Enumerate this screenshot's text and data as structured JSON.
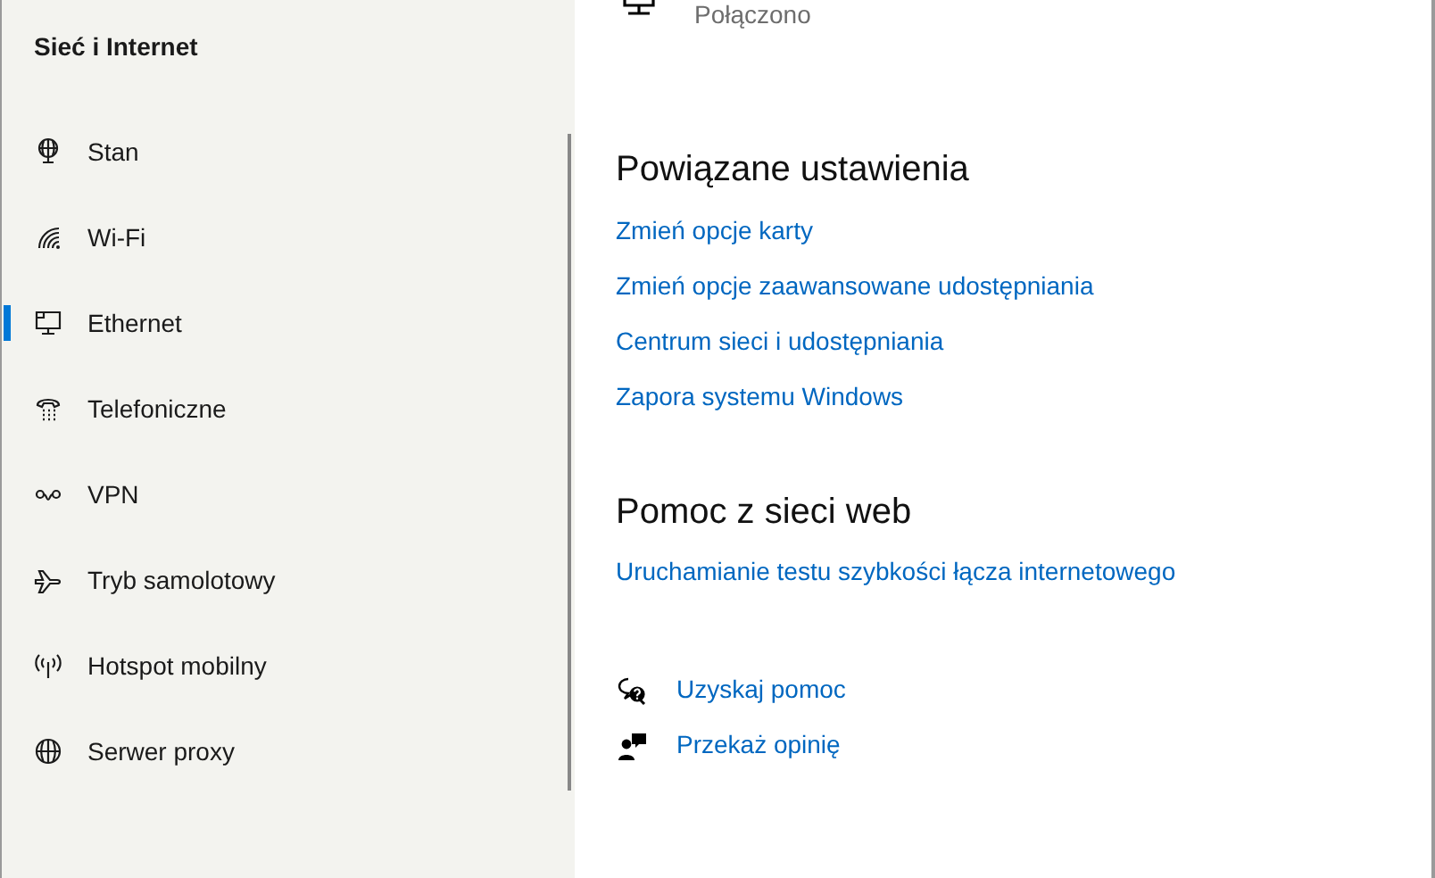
{
  "sidebar": {
    "title": "Sieć i Internet",
    "items": [
      {
        "label": "Stan",
        "kind": "status",
        "selected": false
      },
      {
        "label": "Wi-Fi",
        "kind": "wifi",
        "selected": false
      },
      {
        "label": "Ethernet",
        "kind": "ethernet",
        "selected": true
      },
      {
        "label": "Telefoniczne",
        "kind": "dialup",
        "selected": false
      },
      {
        "label": "VPN",
        "kind": "vpn",
        "selected": false
      },
      {
        "label": "Tryb samolotowy",
        "kind": "airplane",
        "selected": false
      },
      {
        "label": "Hotspot mobilny",
        "kind": "hotspot",
        "selected": false
      },
      {
        "label": "Serwer proxy",
        "kind": "proxy",
        "selected": false
      }
    ]
  },
  "connection": {
    "status": "Połączono"
  },
  "sections": [
    {
      "heading": "Powiązane ustawienia",
      "links": [
        "Zmień opcje karty",
        "Zmień opcje zaawansowane udostępniania",
        "Centrum sieci i udostępniania",
        "Zapora systemu Windows"
      ]
    },
    {
      "heading": "Pomoc z sieci web",
      "links": [
        "Uruchamianie testu szybkości łącza internetowego"
      ]
    }
  ],
  "help_links": [
    {
      "label": "Uzyskaj pomoc",
      "kind": "help"
    },
    {
      "label": "Przekaż opinię",
      "kind": "feedback"
    }
  ]
}
